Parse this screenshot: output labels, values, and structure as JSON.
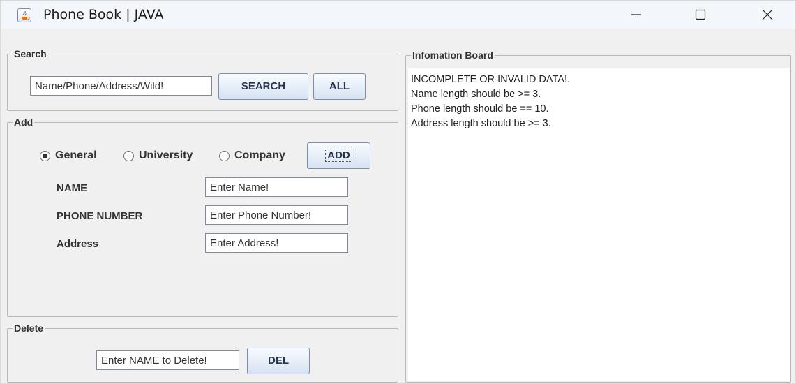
{
  "window": {
    "title": "Phone Book | JAVA",
    "icon": "java-cup-icon"
  },
  "search": {
    "legend": "Search",
    "input_value": "Name/Phone/Address/Wild!",
    "search_label": "SEARCH",
    "all_label": "ALL"
  },
  "add": {
    "legend": "Add",
    "radios": [
      {
        "label": "General",
        "selected": true
      },
      {
        "label": "University",
        "selected": false
      },
      {
        "label": "Company",
        "selected": false
      }
    ],
    "add_label": "ADD",
    "fields": [
      {
        "label": "NAME",
        "value": "Enter Name!"
      },
      {
        "label": "PHONE NUMBER",
        "value": "Enter Phone Number!"
      },
      {
        "label": "Address",
        "value": "Enter Address!"
      }
    ]
  },
  "delete": {
    "legend": "Delete",
    "input_value": "Enter NAME to Delete!",
    "del_label": "DEL"
  },
  "info": {
    "legend": "Infomation Board",
    "lines": [
      "INCOMPLETE OR INVALID DATA!.",
      "Name length should be >= 3.",
      "Phone length should be == 10.",
      "Address length should be >= 3."
    ]
  }
}
